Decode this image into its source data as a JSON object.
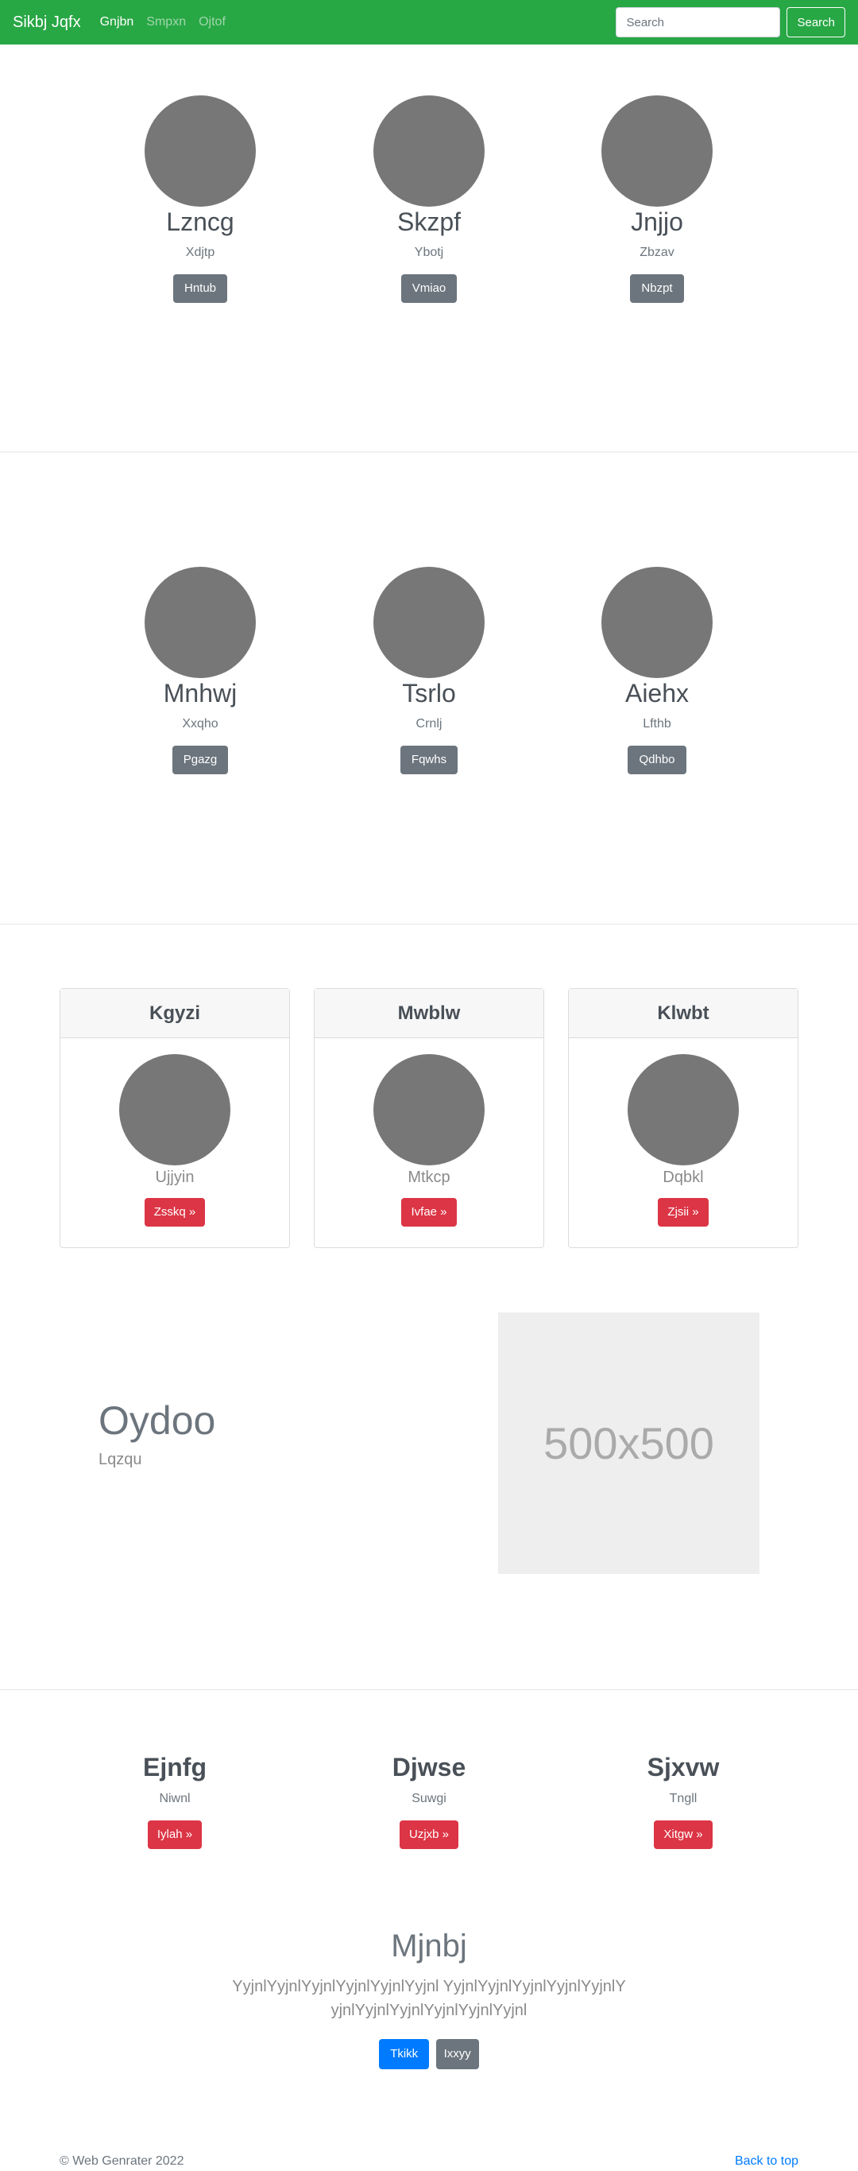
{
  "navbar": {
    "brand": "Sikbj Jqfx",
    "links": [
      "Gnjbn",
      "Smpxn",
      "Ojtof"
    ],
    "search_placeholder": "Search",
    "search_button": "Search"
  },
  "section1": [
    {
      "name": "Lzncg",
      "sub": "Xdjtp",
      "button": "Hntub"
    },
    {
      "name": "Skzpf",
      "sub": "Ybotj",
      "button": "Vmiao"
    },
    {
      "name": "Jnjjo",
      "sub": "Zbzav",
      "button": "Nbzpt"
    }
  ],
  "section2": [
    {
      "name": "Mnhwj",
      "sub": "Xxqho",
      "button": "Pgazg"
    },
    {
      "name": "Tsrlo",
      "sub": "Crnlj",
      "button": "Fqwhs"
    },
    {
      "name": "Aiehx",
      "sub": "Lfthb",
      "button": "Qdhbo"
    }
  ],
  "cards": [
    {
      "header": "Kgyzi",
      "sub": "Ujjyin",
      "button": "Zsskq »"
    },
    {
      "header": "Mwblw",
      "sub": "Mtkcp",
      "button": "Ivfae »"
    },
    {
      "header": "Klwbt",
      "sub": "Dqbkl",
      "button": "Zjsii »"
    }
  ],
  "feature": {
    "title": "Oydoo",
    "sub": "Lqzqu",
    "image_label": "500x500"
  },
  "columns": [
    {
      "title": "Ejnfg",
      "sub": "Niwnl",
      "button": "Iylah »"
    },
    {
      "title": "Djwse",
      "sub": "Suwgi",
      "button": "Uzjxb »"
    },
    {
      "title": "Sjxvw",
      "sub": "Tngll",
      "button": "Xitgw »"
    }
  ],
  "hero": {
    "title": "Mjnbj",
    "lead": "YyjnlYyjnlYyjnlYyjnlYyjnlYyjnl YyjnlYyjnlYyjnlYyjnlYyjnlYyjnlYyjnlYyjnlYyjnlYyjnlYyjnl",
    "primary_button": "Tkikk",
    "secondary_button": "Ixxyy"
  },
  "footer": {
    "copyright": "© Web Genrater 2022",
    "back_to_top": "Back to top"
  },
  "colors": {
    "navbar": "#28a745",
    "secondary": "#6c757d",
    "danger": "#dc3545",
    "primary": "#007bff"
  }
}
